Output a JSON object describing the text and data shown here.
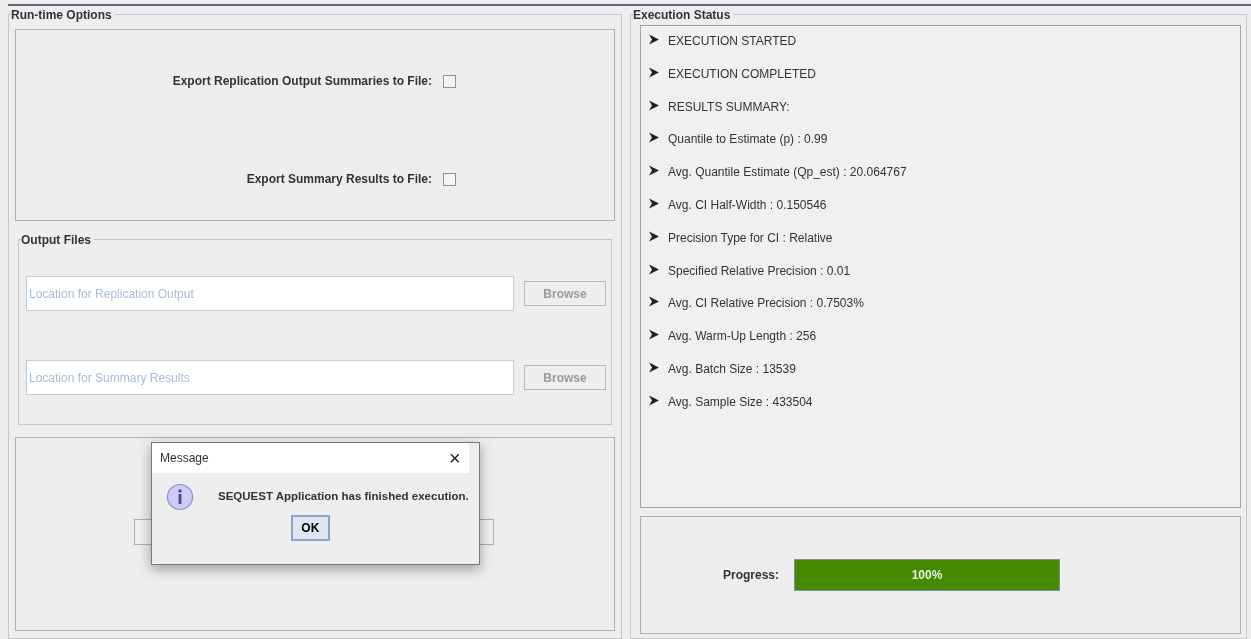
{
  "runtime_options": {
    "title": "Run-time Options",
    "exports": [
      {
        "label": "Export Replication Output Summaries to File:",
        "checked": false
      },
      {
        "label": "Export Summary Results to File:",
        "checked": false
      }
    ],
    "output_files": {
      "title": "Output Files",
      "rows": [
        {
          "placeholder": "Location for Replication Output",
          "button": "Browse"
        },
        {
          "placeholder": "Location for Summary Results",
          "button": "Browse"
        }
      ]
    }
  },
  "execution_status": {
    "title": "Execution Status",
    "lines": [
      "EXECUTION STARTED",
      "EXECUTION COMPLETED",
      "RESULTS SUMMARY:",
      "Quantile to Estimate (p) : 0.99",
      "Avg. Quantile Estimate (Qp_est) : 20.064767",
      "Avg. CI Half-Width : 0.150546",
      "Precision Type for CI : Relative",
      "Specified Relative Precision : 0.01",
      "Avg. CI Relative Precision : 0.7503%",
      "Avg. Warm-Up Length : 256",
      "Avg. Batch Size : 13539",
      "Avg. Sample Size : 433504"
    ],
    "progress": {
      "label": "Progress:",
      "level": 1,
      "reading": "100%"
    }
  },
  "dialog": {
    "title": "Message",
    "close": "×",
    "message": "SEQUEST Application has finished execution.",
    "button": "OK"
  }
}
